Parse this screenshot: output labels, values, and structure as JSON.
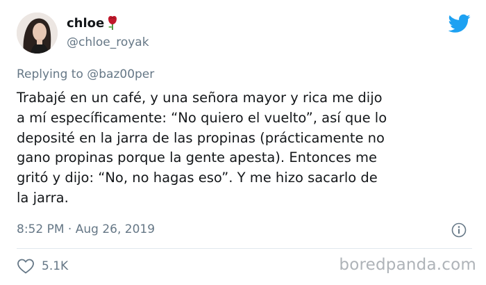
{
  "user": {
    "display_name": "chloe",
    "handle": "@chloe_royak",
    "name_emoji": "rose-icon",
    "avatar": "avatar-photo"
  },
  "brand_icon": "twitter-bird-icon",
  "reply": {
    "prefix": "Replying to",
    "mention": "@baz00per"
  },
  "body_lines": [
    "Trabajé en un café, y una señora mayor y rica me dijo",
    "a mí específicamente: “No quiero el vuelto”, así que lo",
    "deposité en la jarra de las propinas (prácticamente no",
    "gano propinas porque la gente apesta). Entonces me",
    "gritó y dijo: “No, no hagas eso”. Y me hizo sacarlo de",
    "la jarra."
  ],
  "meta": {
    "time": "8:52 PM",
    "separator": "·",
    "date": "Aug 26, 2019"
  },
  "likes": {
    "count": "5.1K",
    "icon": "heart-icon"
  },
  "watermark": "boredpanda.com",
  "colors": {
    "text": "#14171a",
    "secondary": "#657786",
    "twitter_blue": "#1da1f2",
    "divider": "#e1e8ed",
    "watermark": "#aeb3b8",
    "rose_red": "#c0182b"
  }
}
